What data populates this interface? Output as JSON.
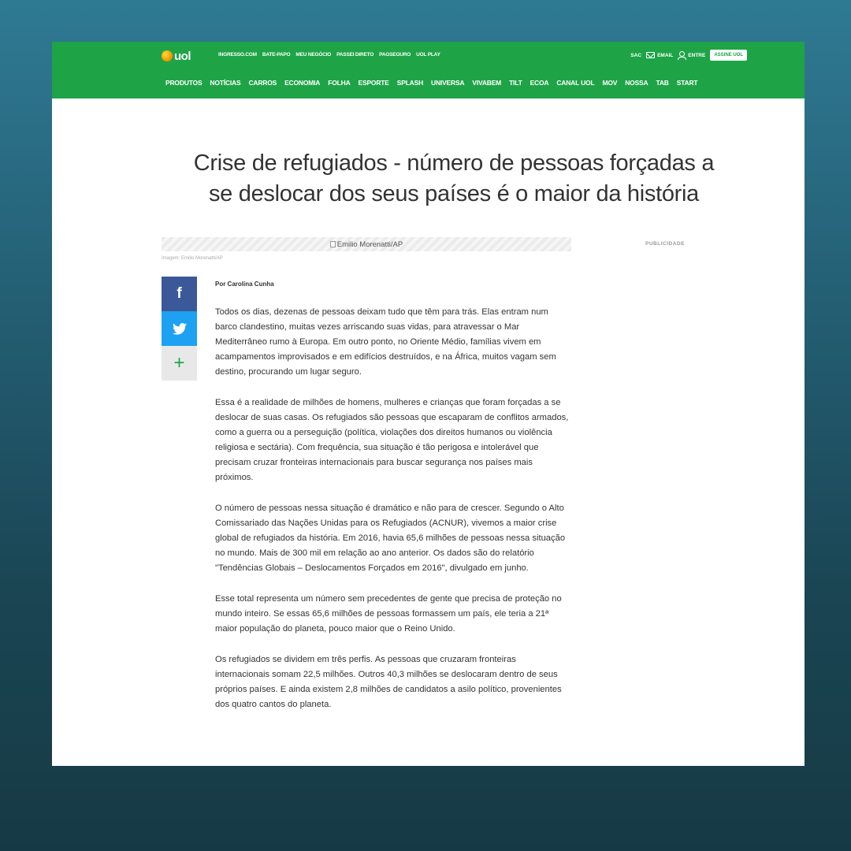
{
  "header": {
    "logo_text": "uol",
    "top_links": [
      "INGRESSO.COM",
      "BATE-PAPO",
      "MEU NEGÓCIO",
      "PASSEI DIRETO",
      "PAGSEGURO",
      "UOL PLAY"
    ],
    "sac_label": "SAC",
    "email_label": "EMAIL",
    "login_label": "ENTRE",
    "subscribe_label": "ASSINE UOL",
    "nav_items": [
      "PRODUTOS",
      "NOTÍCIAS",
      "CARROS",
      "ECONOMIA",
      "FOLHA",
      "ESPORTE",
      "SPLASH",
      "UNIVERSA",
      "VIVABEM",
      "TILT",
      "ECOA",
      "CANAL UOL",
      "MOV",
      "NOSSA",
      "TAB",
      "START"
    ],
    "brand_color": "#1ea447"
  },
  "article": {
    "title": "Crise de refugiados - número de pessoas forçadas a se deslocar dos seus países é o maior da história",
    "image_alt": "Emilio Morenatti/AP",
    "image_caption": "Imagem: Emilio Morenatti/AP",
    "ad_label": "PUBLICIDADE",
    "author": "Por Carolina Cunha",
    "paragraphs": [
      "Todos os dias, dezenas de pessoas deixam tudo que têm para trás. Elas entram num barco clandestino, muitas vezes arriscando suas vidas, para atravessar o Mar Mediterrâneo rumo à Europa. Em outro ponto, no Oriente Médio, famílias vivem em acampamentos improvisados e em edifícios destruídos, e na África, muitos vagam sem destino, procurando um lugar seguro.",
      "Essa é a realidade de milhões de homens, mulheres e crianças que foram forçadas a se deslocar de suas casas. Os refugiados são pessoas que escaparam de conflitos armados, como a guerra ou a perseguição (política, violações dos direitos humanos ou violência religiosa e sectária). Com frequência, sua situação é tão perigosa e intolerável que precisam cruzar fronteiras internacionais para buscar segurança nos países mais próximos.",
      "O número de pessoas nessa situação é dramático e não para de crescer. Segundo o Alto Comissariado das Nações Unidas para os Refugiados (ACNUR), vivemos a maior crise global de refugiados da história. Em 2016, havia 65,6 milhões de pessoas nessa situação no mundo. Mais de 300 mil em relação ao ano anterior. Os dados são do relatório \"Tendências Globais – Deslocamentos Forçados em 2016\", divulgado em junho.",
      "Esse total representa um número sem precedentes de gente que precisa de proteção no mundo inteiro. Se essas 65,6 milhões de pessoas formassem um país, ele teria a 21ª maior população do planeta, pouco maior que o Reino Unido.",
      "Os refugiados se dividem em três perfis. As pessoas que cruzaram fronteiras internacionais somam 22,5 milhões. Outros 40,3 milhões se deslocaram dentro de seus próprios países. E ainda existem 2,8 milhões de candidatos a asilo político, provenientes dos quatro cantos do planeta."
    ]
  },
  "share": {
    "facebook_glyph": "f",
    "more_glyph": "+",
    "icons": [
      "facebook-icon",
      "twitter-icon",
      "plus-icon"
    ]
  }
}
